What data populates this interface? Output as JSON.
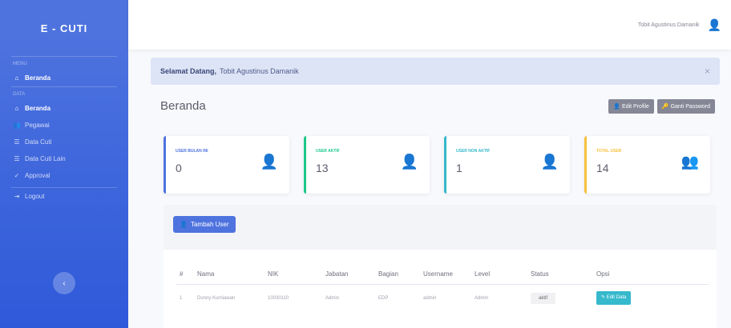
{
  "sidebar": {
    "brand": "E - CUTI",
    "heading1": "MENU",
    "items_top": [
      {
        "label": "Beranda",
        "icon": "home-icon"
      }
    ],
    "heading2": "DATA",
    "items": [
      {
        "label": "Beranda",
        "icon": "home-icon",
        "active": true
      },
      {
        "label": "Pegawai",
        "icon": "users-icon"
      },
      {
        "label": "Data Cuti",
        "icon": "list-icon"
      },
      {
        "label": "Data Cuti Lain",
        "icon": "list-icon"
      },
      {
        "label": "Approval",
        "icon": "check-icon"
      },
      {
        "label": "Logout",
        "icon": "logout-icon"
      }
    ]
  },
  "topbar": {
    "user_name": "Tobit Agustinus Damanik"
  },
  "alert": {
    "greeting": "Selamat Datang,",
    "name": "Tobit Agustinus Damanik"
  },
  "page": {
    "title": "Beranda",
    "edit_profile": "Edit Profile",
    "change_password": "Ganti Password"
  },
  "cards": [
    {
      "label": "USER BULAN INI",
      "value": "0",
      "color": "#4e73df"
    },
    {
      "label": "USER AKTIF",
      "value": "13",
      "color": "#1cc88a"
    },
    {
      "label": "USER NON AKTIF",
      "value": "1",
      "color": "#36b9cc"
    },
    {
      "label": "TOTAL USER",
      "value": "14",
      "color": "#f6c23e"
    }
  ],
  "table": {
    "add_button": "Tambah User",
    "headers": [
      "#",
      "Nama",
      "NIK",
      "Jabatan",
      "Bagian",
      "Username",
      "Level",
      "Status",
      "Opsi"
    ],
    "rows": [
      {
        "no": "1",
        "nama": "Donny Kurniawan",
        "nik": "10030110",
        "jabatan": "Admin",
        "bagian": "EDP",
        "username": "admin",
        "level": "Admin",
        "status": "aktif",
        "opsi": "Edit Data"
      }
    ]
  }
}
